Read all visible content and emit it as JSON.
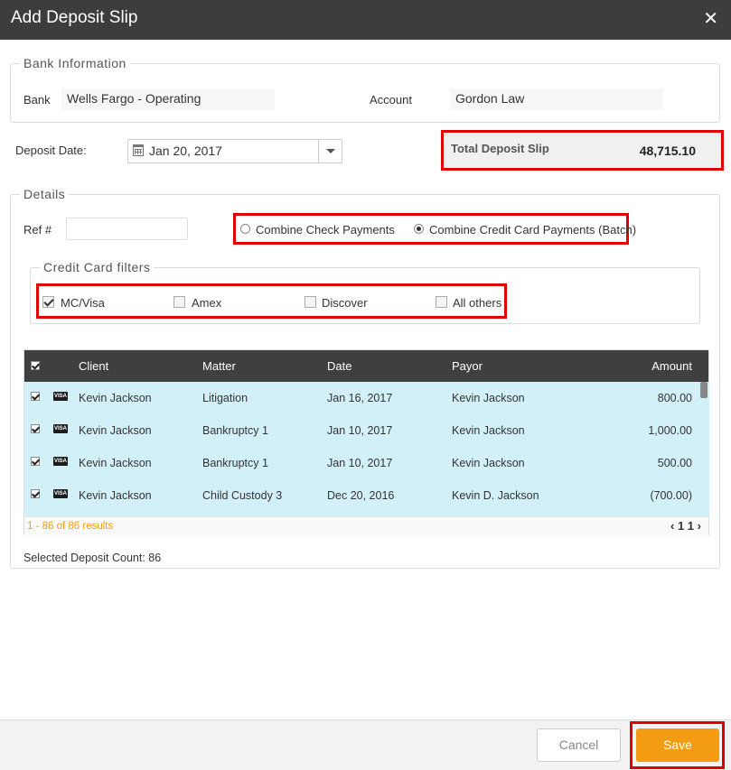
{
  "dialog": {
    "title": "Add Deposit Slip",
    "close_icon": "close-icon"
  },
  "bank_info": {
    "legend": "Bank Information",
    "bank_label": "Bank",
    "bank_value": "Wells Fargo - Operating",
    "account_label": "Account",
    "account_value": "Gordon Law"
  },
  "deposit": {
    "date_label": "Deposit Date:",
    "date_value": "Jan 20, 2017",
    "total_label": "Total Deposit Slip",
    "total_value": "48,715.10"
  },
  "details": {
    "legend": "Details",
    "ref_label": "Ref #",
    "ref_value": "",
    "combine_check_label": "Combine Check Payments",
    "combine_check_selected": false,
    "combine_cc_label": "Combine Credit Card Payments (Batch)",
    "combine_cc_selected": true
  },
  "cc_filters": {
    "legend": "Credit Card filters",
    "items": [
      {
        "label": "MC/Visa",
        "checked": true
      },
      {
        "label": "Amex",
        "checked": false
      },
      {
        "label": "Discover",
        "checked": false
      },
      {
        "label": "All others",
        "checked": false
      }
    ]
  },
  "grid": {
    "columns": [
      "Client",
      "Matter",
      "Date",
      "Payor",
      "Amount"
    ],
    "rows": [
      {
        "checked": true,
        "card": "VISA",
        "client": "Kevin Jackson",
        "matter": "Litigation",
        "date": "Jan 16, 2017",
        "payor": "Kevin Jackson",
        "amount": "800.00"
      },
      {
        "checked": true,
        "card": "VISA",
        "client": "Kevin Jackson",
        "matter": "Bankruptcy 1",
        "date": "Jan 10, 2017",
        "payor": "Kevin Jackson",
        "amount": "1,000.00"
      },
      {
        "checked": true,
        "card": "VISA",
        "client": "Kevin Jackson",
        "matter": "Bankruptcy 1",
        "date": "Jan 10, 2017",
        "payor": "Kevin Jackson",
        "amount": "500.00"
      },
      {
        "checked": true,
        "card": "VISA",
        "client": "Kevin Jackson",
        "matter": "Child Custody 3",
        "date": "Dec 20, 2016",
        "payor": "Kevin D. Jackson",
        "amount": "(700.00)"
      }
    ],
    "results_text": "1 - 86 of 86 results",
    "pager_prev": "‹",
    "pager_page": "1",
    "pager_total": "1",
    "pager_next": "›"
  },
  "selected_count_text": "Selected Deposit Count: 86",
  "footer": {
    "cancel_label": "Cancel",
    "save_label": "Save"
  },
  "colors": {
    "accent": "#f39c12",
    "highlight": "#e00000",
    "row_bg": "#d2f0f8",
    "header_bg": "#3d3d3d"
  }
}
